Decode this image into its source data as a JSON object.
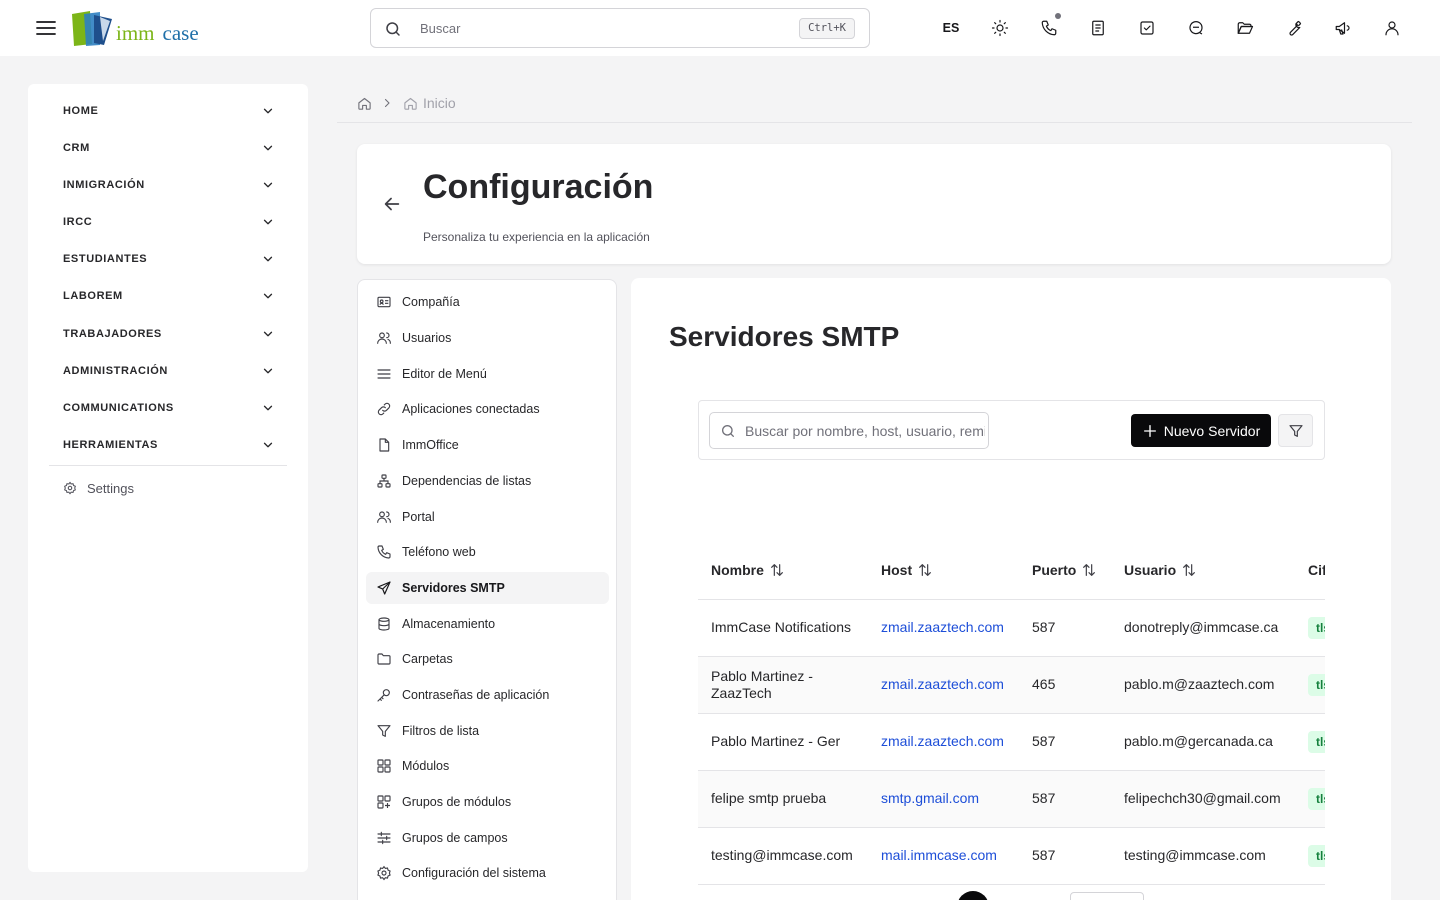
{
  "app": {
    "logo_imm": "imm",
    "logo_case": "case"
  },
  "topbar": {
    "search_placeholder": "Buscar",
    "search_shortcut": "Ctrl+K",
    "language": "ES",
    "icons": [
      "sun-icon",
      "phone-icon",
      "notes-icon",
      "tasks-icon",
      "messages-icon",
      "folder-icon",
      "tools-icon",
      "announcements-icon",
      "user-icon"
    ]
  },
  "sidebar": {
    "items": [
      {
        "label": "HOME"
      },
      {
        "label": "CRM"
      },
      {
        "label": "INMIGRACIÓN"
      },
      {
        "label": "IRCC"
      },
      {
        "label": "ESTUDIANTES"
      },
      {
        "label": "LABOREM"
      },
      {
        "label": "TRABAJADORES"
      },
      {
        "label": "ADMINISTRACIÓN"
      },
      {
        "label": "COMMUNICATIONS"
      },
      {
        "label": "HERRAMIENTAS"
      }
    ],
    "settings_label": "Settings"
  },
  "breadcrumb": {
    "current": "Inicio"
  },
  "header": {
    "title": "Configuración",
    "subtitle": "Personaliza tu experiencia en la aplicación"
  },
  "settings_menu": {
    "active": "Servidores SMTP",
    "items": [
      {
        "label": "Compañía",
        "icon": "company-card-icon"
      },
      {
        "label": "Usuarios",
        "icon": "users-icon"
      },
      {
        "label": "Editor de Menú",
        "icon": "menu-lines-icon"
      },
      {
        "label": "Aplicaciones conectadas",
        "icon": "link-icon"
      },
      {
        "label": "ImmOffice",
        "icon": "file-icon"
      },
      {
        "label": "Dependencias de listas",
        "icon": "hierarchy-icon"
      },
      {
        "label": "Portal",
        "icon": "users-icon"
      },
      {
        "label": "Teléfono web",
        "icon": "phone-icon"
      },
      {
        "label": "Servidores SMTP",
        "icon": "send-icon"
      },
      {
        "label": "Almacenamiento",
        "icon": "database-icon"
      },
      {
        "label": "Carpetas",
        "icon": "folder-icon"
      },
      {
        "label": "Contraseñas de aplicación",
        "icon": "key-icon"
      },
      {
        "label": "Filtros de lista",
        "icon": "filter-icon"
      },
      {
        "label": "Módulos",
        "icon": "grid-icon"
      },
      {
        "label": "Grupos de módulos",
        "icon": "grid-group-icon"
      },
      {
        "label": "Grupos de campos",
        "icon": "sliders-icon"
      },
      {
        "label": "Configuración del sistema",
        "icon": "gear-icon"
      }
    ]
  },
  "smtp": {
    "title": "Servidores SMTP",
    "search_placeholder": "Buscar por nombre, host, usuario, remitente...",
    "new_button": "Nuevo Servidor",
    "columns": [
      "Nombre",
      "Host",
      "Puerto",
      "Usuario",
      "Cifrado"
    ],
    "rows": [
      {
        "name": "ImmCase Notifications",
        "host": "zmail.zaaztech.com",
        "port": "587",
        "user": "donotreply@immcase.ca",
        "encryption": "tls"
      },
      {
        "name": "Pablo Martinez - ZaazTech",
        "host": "zmail.zaaztech.com",
        "port": "465",
        "user": "pablo.m@zaaztech.com",
        "encryption": "tls"
      },
      {
        "name": "Pablo Martinez - Ger",
        "host": "zmail.zaaztech.com",
        "port": "587",
        "user": "pablo.m@gercanada.ca",
        "encryption": "tls"
      },
      {
        "name": "felipe smtp prueba",
        "host": "smtp.gmail.com",
        "port": "587",
        "user": "felipechch30@gmail.com",
        "encryption": "tls"
      },
      {
        "name": "testing@immcase.com",
        "host": "mail.immcase.com",
        "port": "587",
        "user": "testing@immcase.com",
        "encryption": "tls"
      }
    ]
  }
}
